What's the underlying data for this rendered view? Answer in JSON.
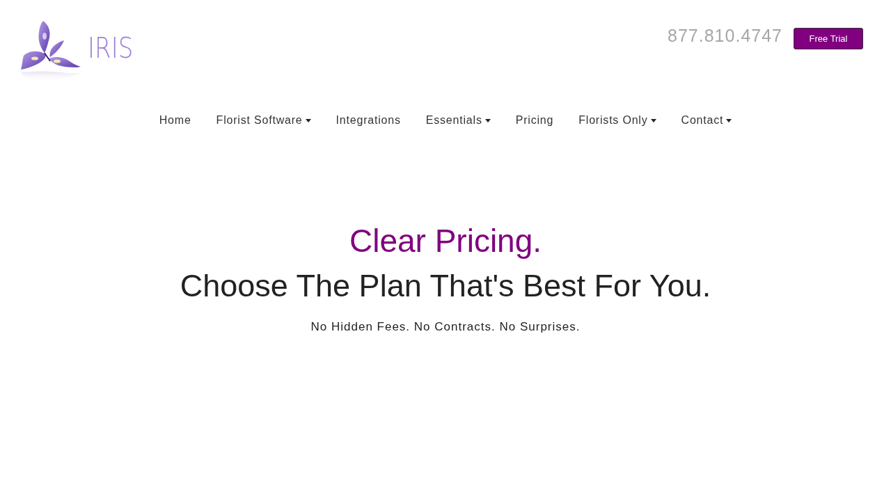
{
  "header": {
    "logo_text": "IRIS",
    "phone": "877.810.4747",
    "cta_button": "Free Trial"
  },
  "nav": [
    {
      "label": "Home",
      "dropdown": false
    },
    {
      "label": "Florist Software",
      "dropdown": true
    },
    {
      "label": "Integrations",
      "dropdown": false
    },
    {
      "label": "Essentials",
      "dropdown": true
    },
    {
      "label": "Pricing",
      "dropdown": false
    },
    {
      "label": "Florists Only",
      "dropdown": true
    },
    {
      "label": "Contact",
      "dropdown": true
    }
  ],
  "hero": {
    "title": "Clear Pricing.",
    "heading": "Choose The Plan That's Best For You.",
    "tagline": "No Hidden Fees. No Contracts. No Surprises."
  }
}
